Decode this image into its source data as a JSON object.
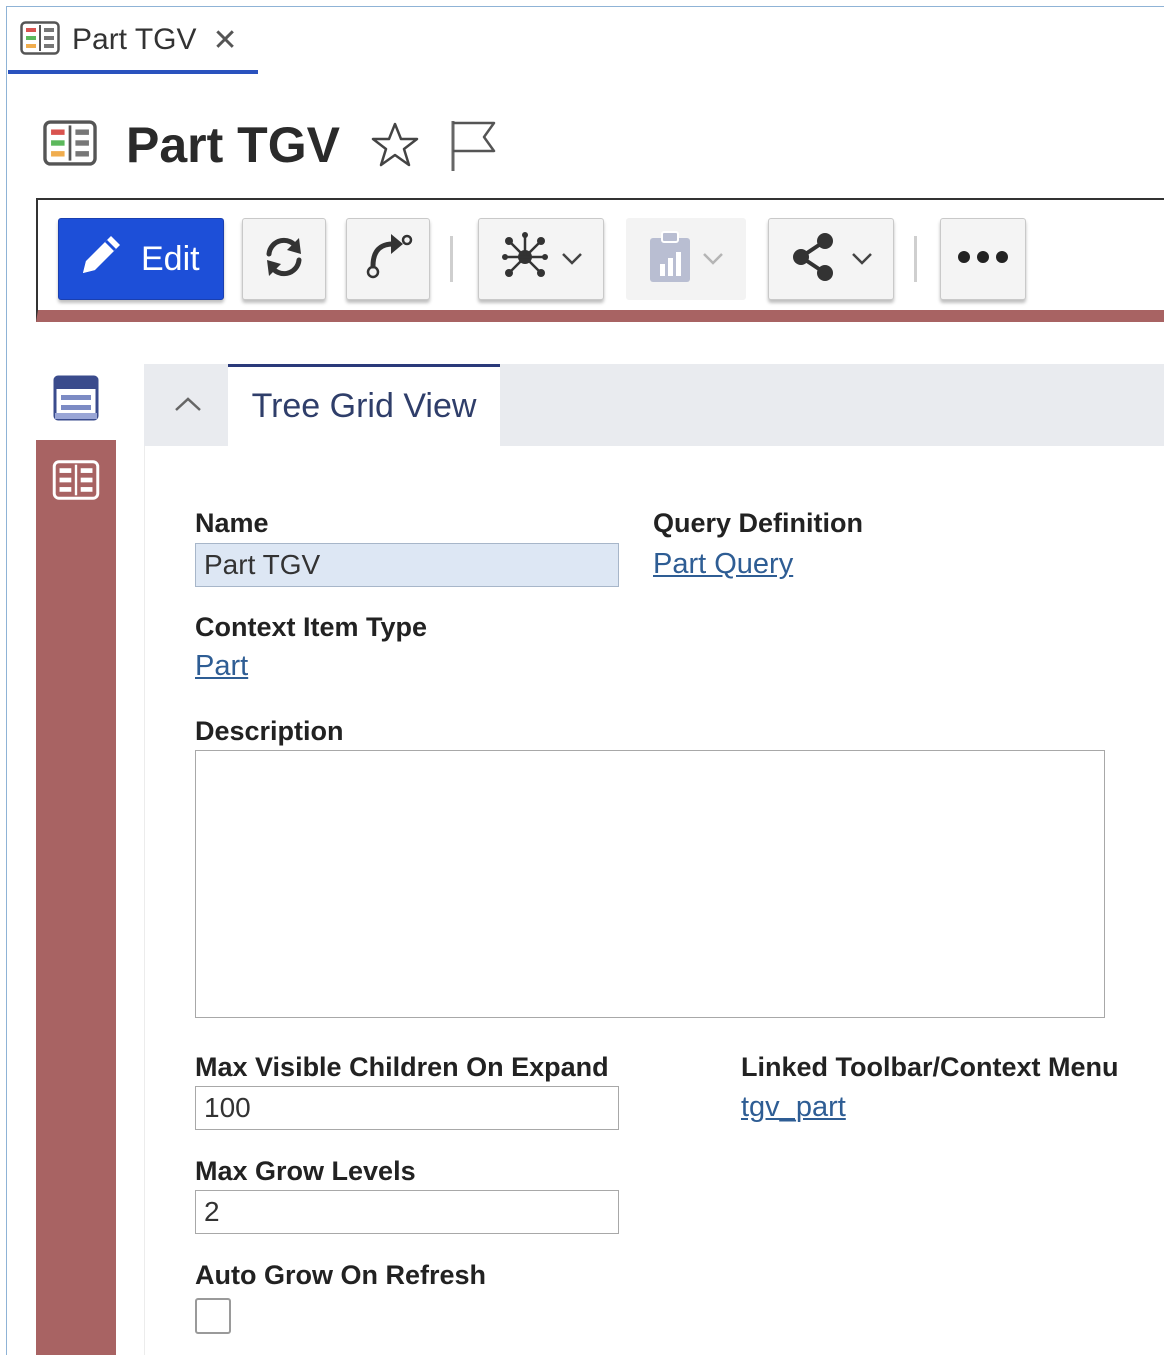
{
  "tab": {
    "title": "Part TGV",
    "close_glyph": "✕",
    "icon": "grid-view-icon"
  },
  "header": {
    "title": "Part TGV",
    "favorite_icon": "star-outline-icon",
    "flag_icon": "flag-outline-icon"
  },
  "toolbar": {
    "edit_label": "Edit",
    "buttons": [
      "pencil-icon",
      "refresh-icon",
      "promote-icon",
      "structure-icon",
      "report-icon",
      "share-icon",
      "more-icon"
    ],
    "accent_color": "#1d4fd8",
    "border_color": "#a86363"
  },
  "sidenav": {
    "items": [
      "form-view-icon",
      "grid-view-icon"
    ]
  },
  "panel": {
    "tab_label": "Tree Grid View"
  },
  "form": {
    "name_label": "Name",
    "name_value": "Part TGV",
    "query_label": "Query Definition",
    "query_link": "Part Query",
    "context_label": "Context Item Type",
    "context_link": "Part",
    "description_label": "Description",
    "description_value": "",
    "max_visible_label": "Max Visible Children On Expand",
    "max_visible_value": "100",
    "linked_label": "Linked Toolbar/Context Menu",
    "linked_link": "tgv_part",
    "max_grow_label": "Max Grow Levels",
    "max_grow_value": "2",
    "auto_grow_label": "Auto Grow On Refresh",
    "auto_grow_checked": false
  }
}
